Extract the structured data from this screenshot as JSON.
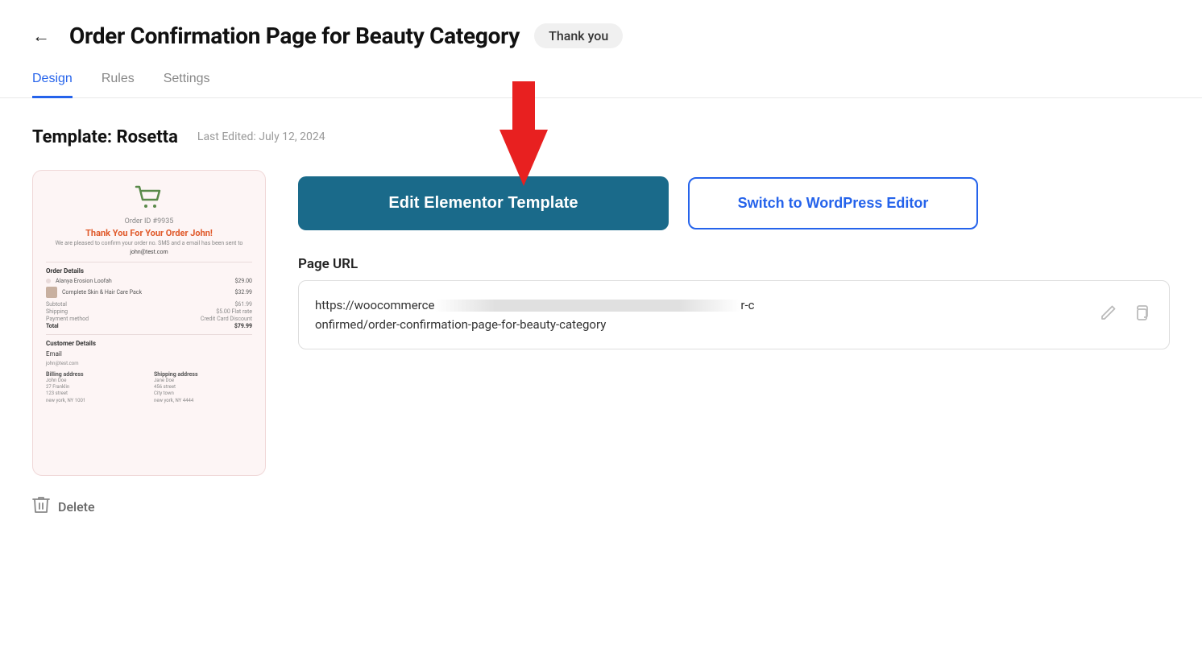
{
  "header": {
    "back_label": "←",
    "title": "Order Confirmation Page for Beauty Category",
    "badge": "Thank you"
  },
  "tabs": [
    {
      "label": "Design",
      "active": true
    },
    {
      "label": "Rules",
      "active": false
    },
    {
      "label": "Settings",
      "active": false
    }
  ],
  "template": {
    "label": "Template: Rosetta",
    "last_edited": "Last Edited: July 12, 2024"
  },
  "preview": {
    "order_id": "Order ID #9935",
    "thank_you_text": "Thank You For Your Order",
    "name_highlight": "John!",
    "subtitle": "We are pleased to confirm your order no. SMS and a email has been sent to",
    "email": "john@test.com",
    "order_details_title": "Order Details",
    "items": [
      {
        "name": "Alanya Erosion Loofah",
        "price": "$29.00"
      },
      {
        "name": "Complete Skin & Hair Care Pack",
        "price": "$32.99"
      }
    ],
    "totals": [
      {
        "label": "Subtotal",
        "value": "$61.99"
      },
      {
        "label": "Shipping",
        "value": "$5.00 Flat rate"
      },
      {
        "label": "Payment method",
        "value": "Credit Card Discount"
      }
    ],
    "grand_total_label": "Total",
    "grand_total_value": "$79.99",
    "customer_details_title": "Customer Details",
    "email_label": "Email",
    "email_value": "john@test.com",
    "billing_title": "Billing address",
    "billing_lines": [
      "John Doe",
      "27 Franklin",
      "123 street",
      "new york, NY 1001"
    ],
    "shipping_title": "Shipping address",
    "shipping_lines": [
      "Jane Doe",
      "456 street",
      "City town",
      "new york, NY 4444"
    ]
  },
  "buttons": {
    "edit_elementor": "Edit Elementor Template",
    "switch_wordpress": "Switch to WordPress Editor"
  },
  "page_url": {
    "label": "Page URL",
    "url_start": "https://woocommerce",
    "url_blurred": "                                                          ",
    "url_end": "r-c",
    "url_second_line": "onfirmed/order-confirmation-page-for-beauty-category"
  },
  "delete": {
    "label": "Delete"
  },
  "colors": {
    "active_tab": "#2563eb",
    "edit_btn_bg": "#1a6a8a",
    "switch_btn_color": "#2563eb",
    "badge_bg": "#f0f0f0"
  }
}
